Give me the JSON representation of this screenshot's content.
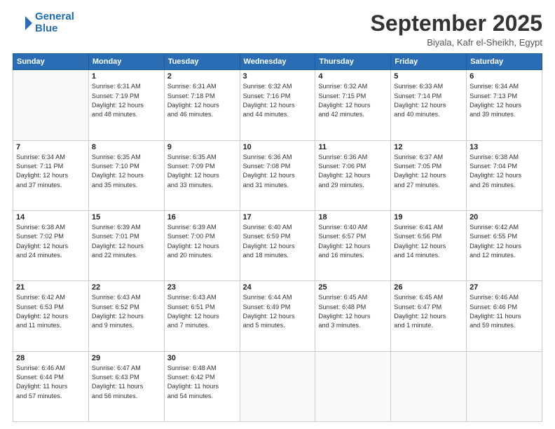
{
  "logo": {
    "line1": "General",
    "line2": "Blue"
  },
  "header": {
    "month": "September 2025",
    "location": "Biyala, Kafr el-Sheikh, Egypt"
  },
  "weekdays": [
    "Sunday",
    "Monday",
    "Tuesday",
    "Wednesday",
    "Thursday",
    "Friday",
    "Saturday"
  ],
  "weeks": [
    [
      {
        "day": "",
        "info": ""
      },
      {
        "day": "1",
        "info": "Sunrise: 6:31 AM\nSunset: 7:19 PM\nDaylight: 12 hours\nand 48 minutes."
      },
      {
        "day": "2",
        "info": "Sunrise: 6:31 AM\nSunset: 7:18 PM\nDaylight: 12 hours\nand 46 minutes."
      },
      {
        "day": "3",
        "info": "Sunrise: 6:32 AM\nSunset: 7:16 PM\nDaylight: 12 hours\nand 44 minutes."
      },
      {
        "day": "4",
        "info": "Sunrise: 6:32 AM\nSunset: 7:15 PM\nDaylight: 12 hours\nand 42 minutes."
      },
      {
        "day": "5",
        "info": "Sunrise: 6:33 AM\nSunset: 7:14 PM\nDaylight: 12 hours\nand 40 minutes."
      },
      {
        "day": "6",
        "info": "Sunrise: 6:34 AM\nSunset: 7:13 PM\nDaylight: 12 hours\nand 39 minutes."
      }
    ],
    [
      {
        "day": "7",
        "info": "Sunrise: 6:34 AM\nSunset: 7:11 PM\nDaylight: 12 hours\nand 37 minutes."
      },
      {
        "day": "8",
        "info": "Sunrise: 6:35 AM\nSunset: 7:10 PM\nDaylight: 12 hours\nand 35 minutes."
      },
      {
        "day": "9",
        "info": "Sunrise: 6:35 AM\nSunset: 7:09 PM\nDaylight: 12 hours\nand 33 minutes."
      },
      {
        "day": "10",
        "info": "Sunrise: 6:36 AM\nSunset: 7:08 PM\nDaylight: 12 hours\nand 31 minutes."
      },
      {
        "day": "11",
        "info": "Sunrise: 6:36 AM\nSunset: 7:06 PM\nDaylight: 12 hours\nand 29 minutes."
      },
      {
        "day": "12",
        "info": "Sunrise: 6:37 AM\nSunset: 7:05 PM\nDaylight: 12 hours\nand 27 minutes."
      },
      {
        "day": "13",
        "info": "Sunrise: 6:38 AM\nSunset: 7:04 PM\nDaylight: 12 hours\nand 26 minutes."
      }
    ],
    [
      {
        "day": "14",
        "info": "Sunrise: 6:38 AM\nSunset: 7:02 PM\nDaylight: 12 hours\nand 24 minutes."
      },
      {
        "day": "15",
        "info": "Sunrise: 6:39 AM\nSunset: 7:01 PM\nDaylight: 12 hours\nand 22 minutes."
      },
      {
        "day": "16",
        "info": "Sunrise: 6:39 AM\nSunset: 7:00 PM\nDaylight: 12 hours\nand 20 minutes."
      },
      {
        "day": "17",
        "info": "Sunrise: 6:40 AM\nSunset: 6:59 PM\nDaylight: 12 hours\nand 18 minutes."
      },
      {
        "day": "18",
        "info": "Sunrise: 6:40 AM\nSunset: 6:57 PM\nDaylight: 12 hours\nand 16 minutes."
      },
      {
        "day": "19",
        "info": "Sunrise: 6:41 AM\nSunset: 6:56 PM\nDaylight: 12 hours\nand 14 minutes."
      },
      {
        "day": "20",
        "info": "Sunrise: 6:42 AM\nSunset: 6:55 PM\nDaylight: 12 hours\nand 12 minutes."
      }
    ],
    [
      {
        "day": "21",
        "info": "Sunrise: 6:42 AM\nSunset: 6:53 PM\nDaylight: 12 hours\nand 11 minutes."
      },
      {
        "day": "22",
        "info": "Sunrise: 6:43 AM\nSunset: 6:52 PM\nDaylight: 12 hours\nand 9 minutes."
      },
      {
        "day": "23",
        "info": "Sunrise: 6:43 AM\nSunset: 6:51 PM\nDaylight: 12 hours\nand 7 minutes."
      },
      {
        "day": "24",
        "info": "Sunrise: 6:44 AM\nSunset: 6:49 PM\nDaylight: 12 hours\nand 5 minutes."
      },
      {
        "day": "25",
        "info": "Sunrise: 6:45 AM\nSunset: 6:48 PM\nDaylight: 12 hours\nand 3 minutes."
      },
      {
        "day": "26",
        "info": "Sunrise: 6:45 AM\nSunset: 6:47 PM\nDaylight: 12 hours\nand 1 minute."
      },
      {
        "day": "27",
        "info": "Sunrise: 6:46 AM\nSunset: 6:46 PM\nDaylight: 11 hours\nand 59 minutes."
      }
    ],
    [
      {
        "day": "28",
        "info": "Sunrise: 6:46 AM\nSunset: 6:44 PM\nDaylight: 11 hours\nand 57 minutes."
      },
      {
        "day": "29",
        "info": "Sunrise: 6:47 AM\nSunset: 6:43 PM\nDaylight: 11 hours\nand 56 minutes."
      },
      {
        "day": "30",
        "info": "Sunrise: 6:48 AM\nSunset: 6:42 PM\nDaylight: 11 hours\nand 54 minutes."
      },
      {
        "day": "",
        "info": ""
      },
      {
        "day": "",
        "info": ""
      },
      {
        "day": "",
        "info": ""
      },
      {
        "day": "",
        "info": ""
      }
    ]
  ]
}
